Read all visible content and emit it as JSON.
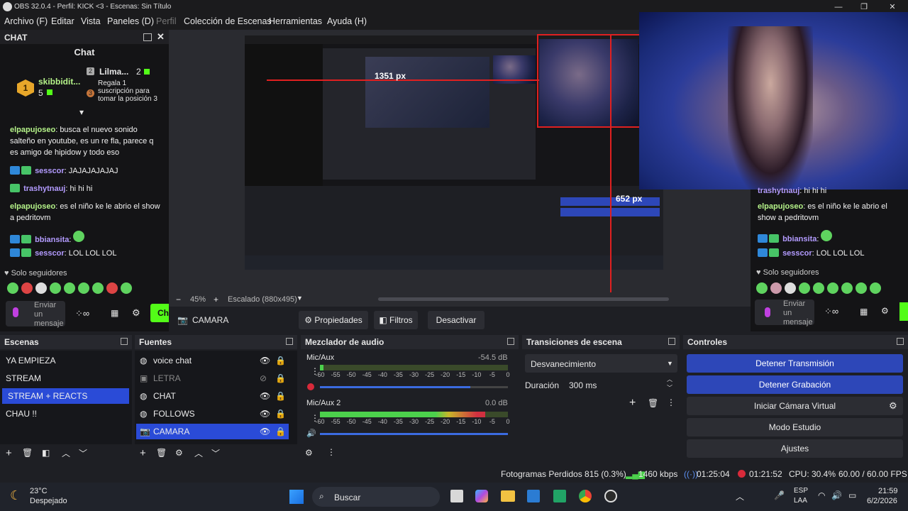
{
  "window": {
    "title": "OBS 32.0.4 - Perfil: KICK <3 - Escenas: Sin Título"
  },
  "menu": [
    "Archivo (F)",
    "Editar",
    "Vista",
    "Paneles (D)",
    "Perfil",
    "Colección de Escenas",
    "Herramientas",
    "Ayuda (H)"
  ],
  "chat": {
    "dock_title": "CHAT",
    "panel_title": "Chat",
    "top_user": "skibbidit...",
    "top_count": "5",
    "top_rank": "1",
    "gift_user": "Lilma...",
    "gift_rank": "2",
    "gift_count": "2",
    "gift_rank_badge": "3",
    "gift_text": "Regala 1 suscripción para tomar la posición 3",
    "messages": [
      {
        "user": "elpapujoseo",
        "text": "busca el nuevo sonido salteño en youtube, es un re fla, parece q es amigo de hipidow y todo eso",
        "color": "g"
      },
      {
        "user": "sesscor",
        "text": "JAJAJAJAJAJ",
        "color": "p"
      },
      {
        "user": "trashytnauj",
        "text": "hi hi hi",
        "color": "p"
      },
      {
        "user": "elpapujoseo",
        "text": "es el niño ke le abrio el show a pedritovm",
        "color": "g"
      },
      {
        "user": "bbiansita",
        "text": "",
        "color": "p"
      },
      {
        "user": "sesscor",
        "text": "LOL LOL LOL",
        "color": "p"
      }
    ],
    "followers_only": "Solo seguidores",
    "send_placeholder": "Enviar un mensaje",
    "chat_button": "Ch"
  },
  "right_chat": {
    "messages": [
      {
        "user": "trashytnauj",
        "text": "hi hi hi"
      },
      {
        "user": "elpapujoseo",
        "text": "es el niño ke le abrio el show a pedritovm"
      },
      {
        "user": "bbiansita",
        "text": ""
      },
      {
        "user": "sesscor",
        "text": "LOL LOL LOL"
      }
    ],
    "followers_only": "Solo seguidores",
    "send_placeholder": "Enviar un mensaje"
  },
  "preview": {
    "measure_h": "1351 px",
    "measure_v": "652 px",
    "zoom": "45%",
    "scale": "Escalado (880x495)"
  },
  "source_toolbar": {
    "source": "CAMARA",
    "properties": "Propiedades",
    "filters": "Filtros",
    "deactivate": "Desactivar"
  },
  "scenes": {
    "title": "Escenas",
    "items": [
      "YA EMPIEZA",
      "STREAM",
      "STREAM + REACTS",
      "CHAU !!"
    ],
    "selected": 2
  },
  "sources": {
    "title": "Fuentes",
    "items": [
      "voice chat",
      "LETRA",
      "CHAT",
      "FOLLOWS",
      "CAMARA"
    ],
    "selected": 4
  },
  "mixer": {
    "title": "Mezclador de audio",
    "channels": [
      {
        "name": "Mic/Aux",
        "db": "-54.5 dB",
        "level": 0.02,
        "volume": 0.8
      },
      {
        "name": "Mic/Aux 2",
        "db": "0.0 dB",
        "level": 0.88,
        "volume": 1.0
      }
    ],
    "ticks": [
      "-60",
      "-55",
      "-50",
      "-45",
      "-40",
      "-35",
      "-30",
      "-25",
      "-20",
      "-15",
      "-10",
      "-5",
      "0"
    ]
  },
  "transitions": {
    "title": "Transiciones de escena",
    "selected": "Desvanecimiento",
    "duration_label": "Duración",
    "duration_value": "300 ms"
  },
  "controls": {
    "title": "Controles",
    "buttons": [
      "Detener Transmisión",
      "Detener Grabación",
      "Iniciar Cámara Virtual",
      "Modo Estudio",
      "Ajustes"
    ]
  },
  "status": {
    "dropped": "Fotogramas Perdidos 815 (0.3%)",
    "bitrate": "1460 kbps",
    "stream_time": "01:25:04",
    "rec_time": "01:21:52",
    "cpu": "CPU: 30.4%",
    "fps": "60.00 / 60.00 FPS"
  },
  "taskbar": {
    "temp": "23°C",
    "weather": "Despejado",
    "search": "Buscar",
    "lang1": "ESP",
    "lang2": "LAA",
    "time": "21:59",
    "date": "6/2/2026"
  },
  "colors": {
    "accent": "#2a4bd7",
    "kick_green": "#53fc18"
  }
}
